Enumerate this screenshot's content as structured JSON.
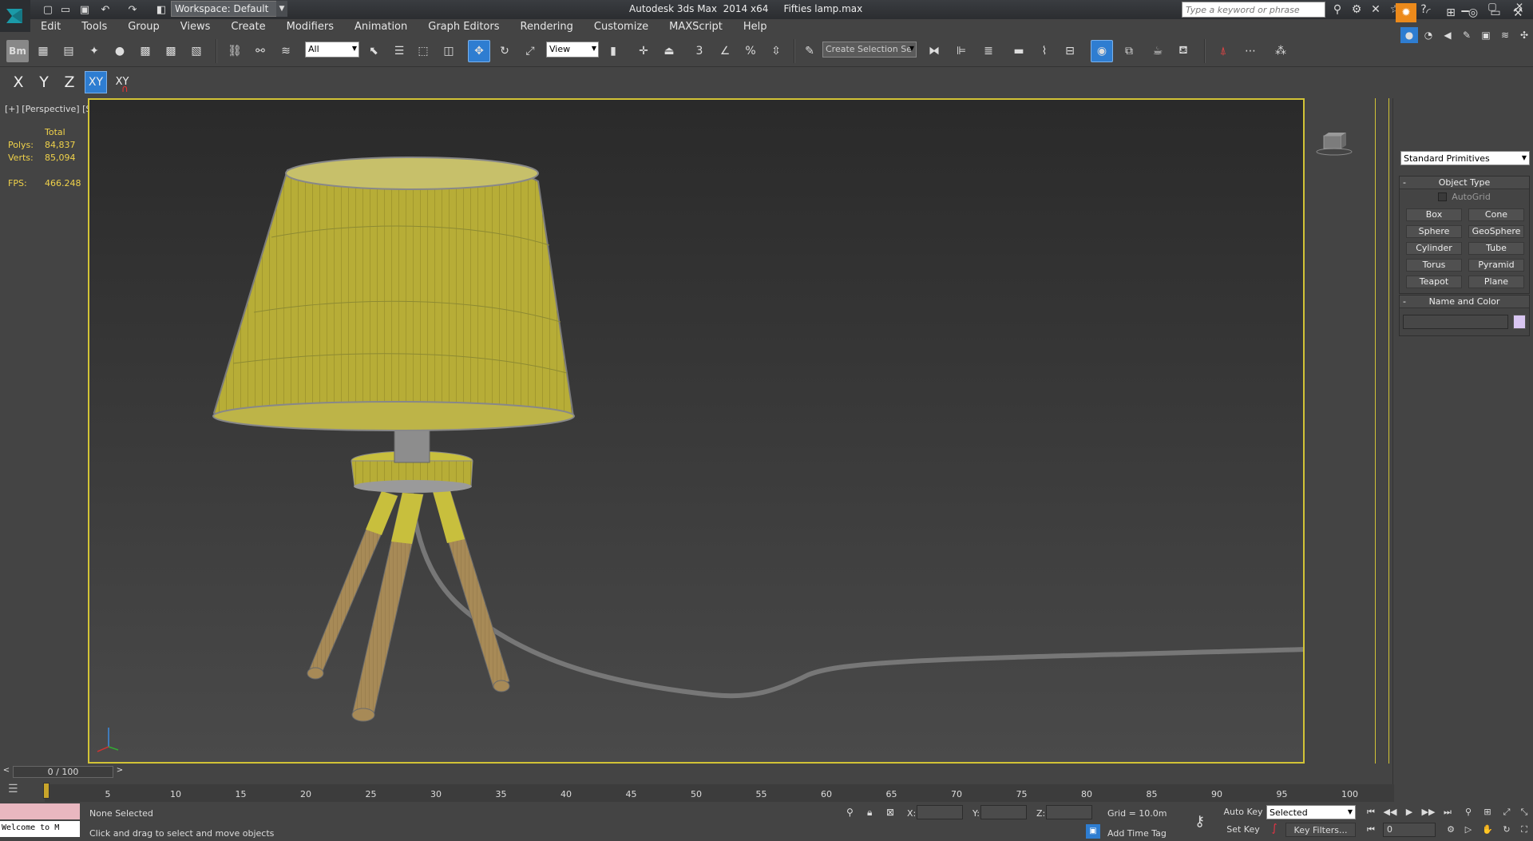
{
  "titlebar": {
    "workspace": "Workspace: Default",
    "app_title": "Autodesk 3ds Max  2014 x64",
    "file_name": "Fifties lamp.max",
    "search_placeholder": "Type a keyword or phrase"
  },
  "menu": [
    "Edit",
    "Tools",
    "Group",
    "Views",
    "Create",
    "Modifiers",
    "Animation",
    "Graph Editors",
    "Rendering",
    "Customize",
    "MAXScript",
    "Help"
  ],
  "toolbar": {
    "selection_filter": "All",
    "ref_coord": "View",
    "snap_3": "3",
    "percent_snap": "%",
    "named_selection": "Create Selection Se"
  },
  "axis_constraints": {
    "x": "X",
    "y": "Y",
    "z": "Z",
    "xy": "XY",
    "xy_snap": "XY"
  },
  "viewport": {
    "label": "[+] [Perspective] [Shaded + Edged Faces]",
    "stats_header": "Total",
    "polys_label": "Polys:",
    "polys": "84,837",
    "verts_label": "Verts:",
    "verts": "85,094",
    "fps_label": "FPS:",
    "fps": "466.248"
  },
  "command_panel": {
    "category": "Standard Primitives",
    "object_type_title": "Object Type",
    "autogrid": "AutoGrid",
    "primitives": [
      "Box",
      "Cone",
      "Sphere",
      "GeoSphere",
      "Cylinder",
      "Tube",
      "Torus",
      "Pyramid",
      "Teapot",
      "Plane"
    ],
    "name_color_title": "Name and Color",
    "swatch_color": "#d9c6f2"
  },
  "timeline": {
    "frame_display": "0 / 100",
    "ticks": [
      "5",
      "10",
      "15",
      "20",
      "25",
      "30",
      "35",
      "40",
      "45",
      "50",
      "55",
      "60",
      "65",
      "70",
      "75",
      "80",
      "85",
      "90",
      "95",
      "100"
    ]
  },
  "status": {
    "maxscript_output": "Welcome to M",
    "selection": "None Selected",
    "prompt": "Click and drag to select and move objects",
    "x_label": "X:",
    "y_label": "Y:",
    "z_label": "Z:",
    "grid": "Grid = 10.0m",
    "add_time_tag": "Add Time Tag",
    "auto_key": "Auto Key",
    "set_key": "Set Key",
    "key_mode": "Selected",
    "key_filters": "Key Filters...",
    "current_frame": "0"
  },
  "colors": {
    "accent": "#2e7dd1",
    "viewport_border": "#d2c336",
    "create_tab": "#ec8a1b",
    "stats_text": "#f0d24a"
  }
}
